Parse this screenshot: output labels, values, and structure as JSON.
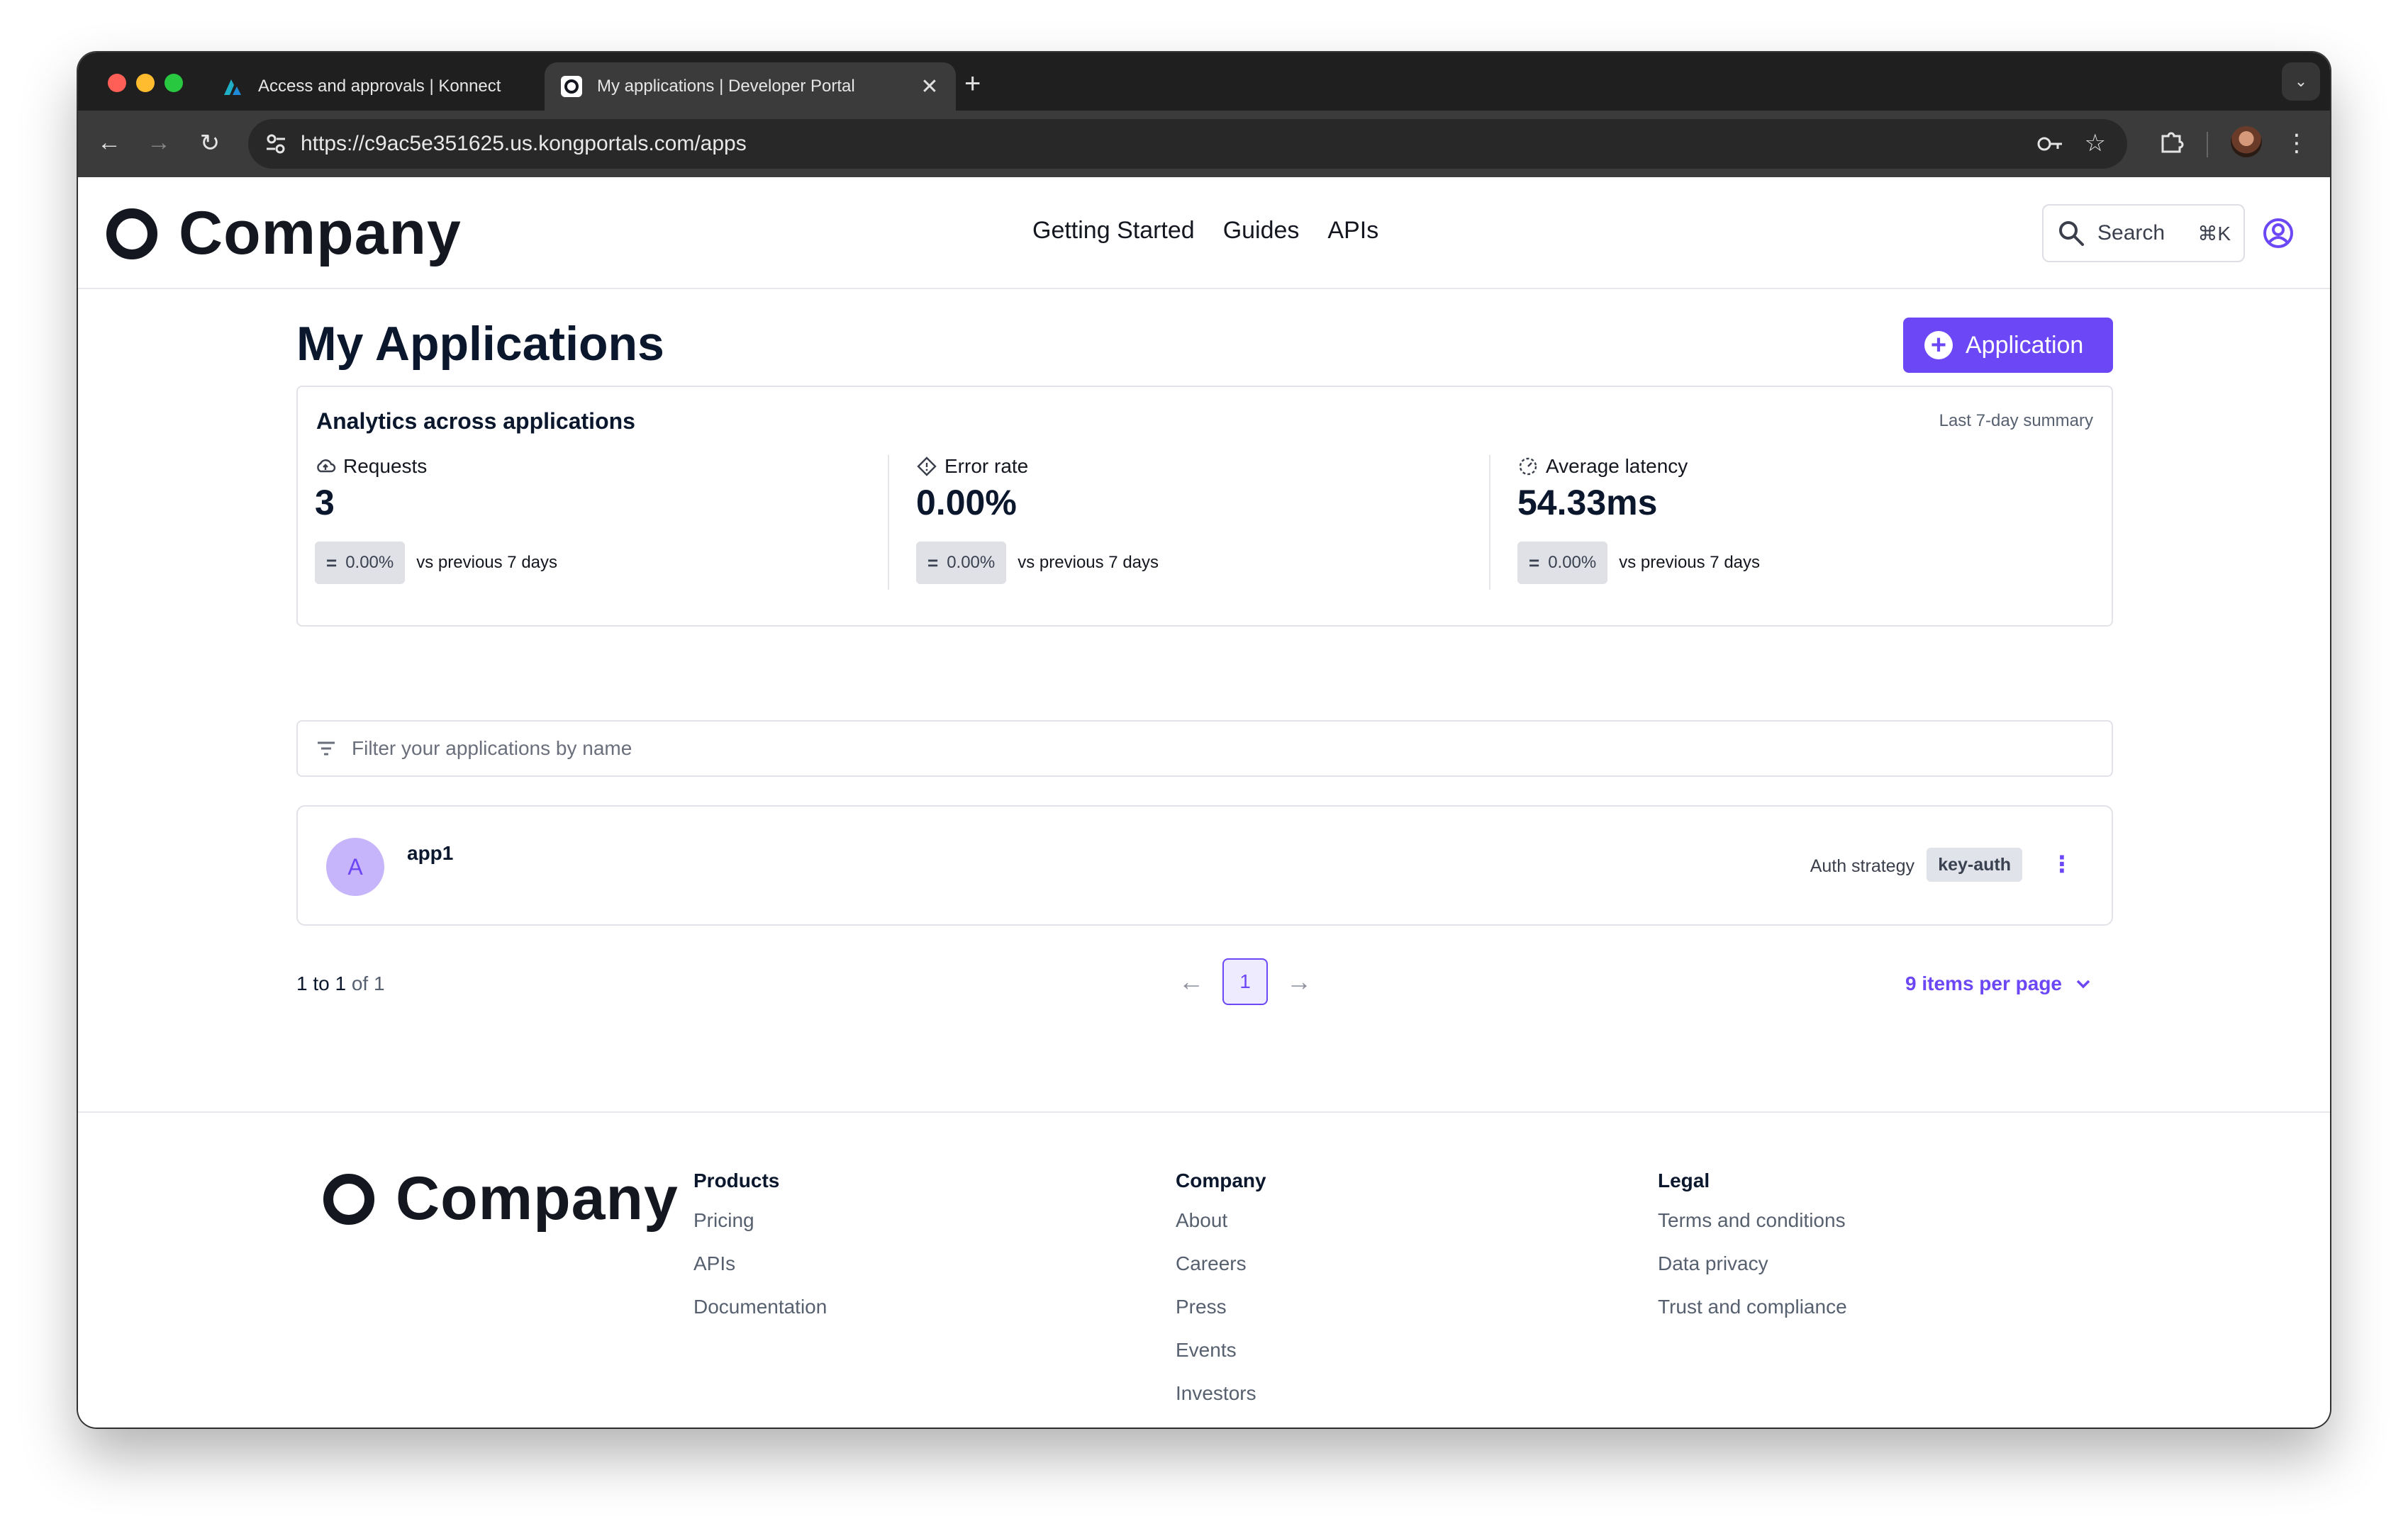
{
  "browser": {
    "tabs": [
      {
        "title": "Access and approvals | Konnect",
        "active": false
      },
      {
        "title": "My applications | Developer Portal",
        "active": true
      }
    ],
    "url": "https://c9ac5e351625.us.kongportals.com/apps"
  },
  "header": {
    "brand": "Company",
    "nav": [
      "Getting Started",
      "Guides",
      "APIs"
    ],
    "search_label": "Search",
    "search_shortcut": "⌘K"
  },
  "main": {
    "title": "My Applications",
    "add_button_label": "Application",
    "analytics": {
      "title": "Analytics across applications",
      "period": "Last 7-day summary",
      "metrics": [
        {
          "label": "Requests",
          "value": "3",
          "change": "0.00%",
          "comparison": "vs previous 7 days",
          "icon": "cloud-icon"
        },
        {
          "label": "Error rate",
          "value": "0.00%",
          "change": "0.00%",
          "comparison": "vs previous 7 days",
          "icon": "diamond-alert-icon"
        },
        {
          "label": "Average latency",
          "value": "54.33ms",
          "change": "0.00%",
          "comparison": "vs previous 7 days",
          "icon": "gauge-icon"
        }
      ]
    },
    "filter_placeholder": "Filter your applications by name",
    "apps": [
      {
        "avatar_letter": "A",
        "name": "app1",
        "auth_label": "Auth strategy",
        "auth_strategy": "key-auth"
      }
    ],
    "pagination": {
      "from": "1",
      "to_word": "to",
      "to": "1",
      "of_word": "of",
      "total": "1",
      "current_page": "1",
      "per_page_label": "9 items per page"
    }
  },
  "footer": {
    "brand": "Company",
    "columns": [
      {
        "heading": "Products",
        "links": [
          "Pricing",
          "APIs",
          "Documentation"
        ]
      },
      {
        "heading": "Company",
        "links": [
          "About",
          "Careers",
          "Press",
          "Events",
          "Investors"
        ]
      },
      {
        "heading": "Legal",
        "links": [
          "Terms and conditions",
          "Data privacy",
          "Trust and compliance"
        ]
      }
    ]
  },
  "colors": {
    "accent": "#6c47f5",
    "heading": "#0b172d",
    "muted": "#57606f"
  }
}
